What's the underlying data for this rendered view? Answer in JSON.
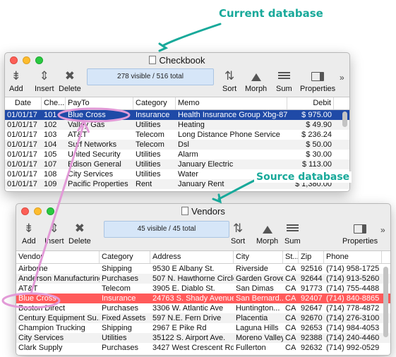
{
  "annotations": {
    "current": "Current database",
    "source": "Source database"
  },
  "colors": {
    "annotation": "#18a99a",
    "pointer_arrow": "#e29ad7",
    "selection_blue": "#1f4aa7",
    "highlight_red": "#ff5a5a"
  },
  "checkbook": {
    "title": "Checkbook",
    "status": "278 visible / 516 total",
    "toolbar": {
      "add": "Add",
      "insert": "Insert",
      "delete": "Delete",
      "sort": "Sort",
      "morph": "Morph",
      "sum": "Sum",
      "properties": "Properties",
      "more": "»"
    },
    "columns": [
      "Date",
      "Che...",
      "PayTo",
      "Category",
      "Memo",
      "Debit"
    ],
    "rows": [
      [
        "01/01/17",
        "101",
        "Blue Cross",
        "Insurance",
        "Health Insurance Group Xbg-872",
        "$ 975.00"
      ],
      [
        "01/01/17",
        "102",
        "Valley Gas",
        "Utilities",
        "Heating",
        "$ 49.90"
      ],
      [
        "01/01/17",
        "103",
        "AT&T",
        "Telecom",
        "Long Distance Phone Service",
        "$ 236.24"
      ],
      [
        "01/01/17",
        "104",
        "Surf Networks",
        "Telecom",
        "Dsl",
        "$ 50.00"
      ],
      [
        "01/01/17",
        "105",
        "United Security",
        "Utilities",
        "Alarm",
        "$ 30.00"
      ],
      [
        "01/01/17",
        "107",
        "Edison General",
        "Utilities",
        "January Electric",
        "$ 113.00"
      ],
      [
        "01/01/17",
        "108",
        "City Services",
        "Utilities",
        "Water",
        ""
      ],
      [
        "01/01/17",
        "109",
        "Pacific Properties",
        "Rent",
        "January Rent",
        "$ 1,380.00"
      ]
    ]
  },
  "vendors": {
    "title": "Vendors",
    "status": "45 visible / 45 total",
    "toolbar": {
      "add": "Add",
      "insert": "Insert",
      "delete": "Delete",
      "sort": "Sort",
      "morph": "Morph",
      "sum": "Sum",
      "properties": "Properties",
      "more": "»"
    },
    "columns": [
      "Vendor",
      "Category",
      "Address",
      "City",
      "St...",
      "Zip",
      "Phone"
    ],
    "rows": [
      [
        "Airborne",
        "Shipping",
        "9530 E Albany St.",
        "Riverside",
        "CA",
        "92516",
        "(714) 958-1725"
      ],
      [
        "Anderson Manufacturing",
        "Purchases",
        "507 N. Hawthorne Circle",
        "Garden Grove",
        "CA",
        "92644",
        "(714) 913-5260"
      ],
      [
        "AT&T",
        "Telecom",
        "3905 E. Diablo St.",
        "San Dimas",
        "CA",
        "91773",
        "(714) 755-4488"
      ],
      [
        "Blue Cross",
        "Insurance",
        "24763 S. Shady Avenue",
        "San Bernard...",
        "CA",
        "92407",
        "(714) 840-8865"
      ],
      [
        "Boston Direct",
        "Purchases",
        "3306 W. Atlantic Ave",
        "Huntington...",
        "CA",
        "92647",
        "(714) 778-4872"
      ],
      [
        "Century Equipment Su...",
        "Fixed Assets",
        "597 N.E. Fern Drive",
        "Placentia",
        "CA",
        "92670",
        "(714) 276-3100"
      ],
      [
        "Champion Trucking",
        "Shipping",
        "2967 E Pike Rd",
        "Laguna Hills",
        "CA",
        "92653",
        "(714) 984-4053"
      ],
      [
        "City Services",
        "Utilities",
        "35122 S. Airport Ave.",
        "Moreno Valley",
        "CA",
        "92388",
        "(714) 240-4460"
      ],
      [
        "Clark Supply",
        "Purchases",
        "3427 West Crescent Rd",
        "Fullerton",
        "CA",
        "92632",
        "(714) 992-0529"
      ]
    ]
  }
}
